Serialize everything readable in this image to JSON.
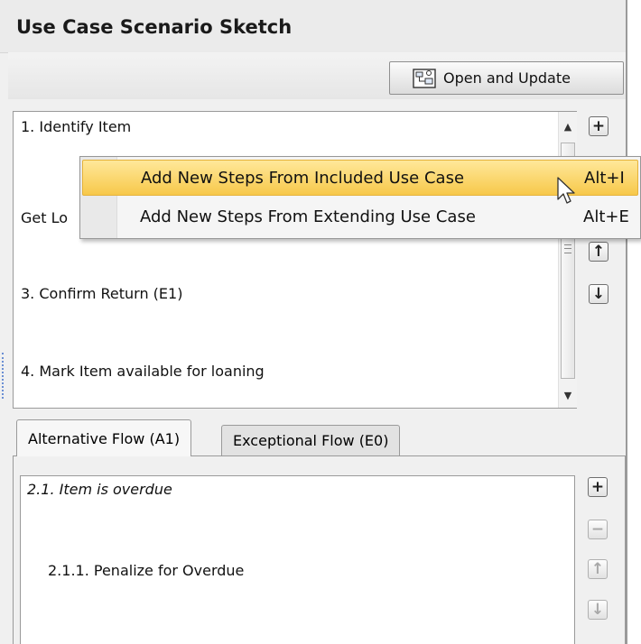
{
  "panel": {
    "title": "Use Case Scenario Sketch"
  },
  "toolbar": {
    "open_update_label": "Open and Update",
    "open_update_icon": "diagram-update-icon"
  },
  "steps": [
    {
      "label": "1. Identify Item"
    },
    {
      "label": "Get Lo"
    },
    {
      "label": "3. Confirm Return (E1)"
    },
    {
      "label": "4. Mark Item available for loaning"
    }
  ],
  "context_menu": {
    "items": [
      {
        "label": "Add New Steps From Included Use Case",
        "shortcut": "Alt+I",
        "highlighted": true
      },
      {
        "label": "Add New Steps From Extending Use Case",
        "shortcut": "Alt+E",
        "highlighted": false
      }
    ]
  },
  "side_buttons": {
    "add": "+",
    "move_up": "↑",
    "move_down": "↓"
  },
  "tabs": [
    {
      "label": "Alternative Flow (A1)",
      "active": true
    },
    {
      "label": "Exceptional Flow (E0)",
      "active": false
    }
  ],
  "flow": {
    "items": [
      {
        "label": "2.1. Item is overdue"
      },
      {
        "label": "2.1.1. Penalize for Overdue"
      }
    ],
    "side_buttons": {
      "add": "+",
      "remove": "−",
      "move_up": "↑",
      "move_down": "↓"
    }
  },
  "colors": {
    "menu_highlight": "#f7c84a",
    "panel_bg": "#f0f0f0"
  }
}
